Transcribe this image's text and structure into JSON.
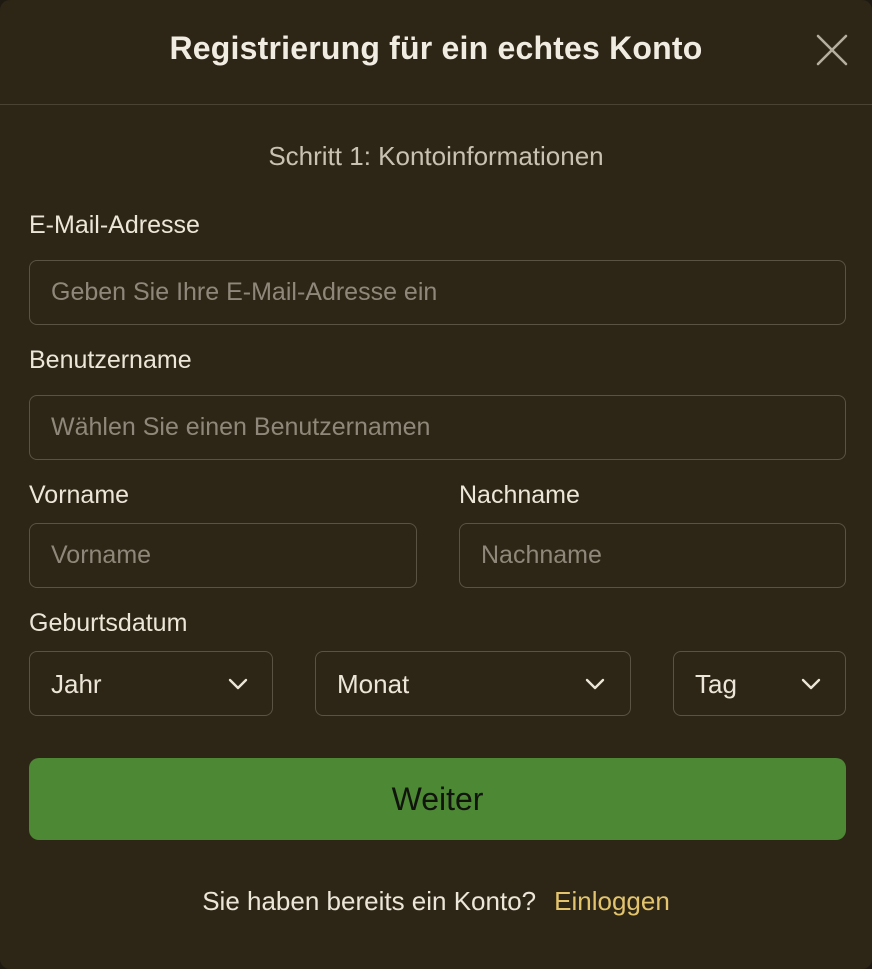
{
  "dialog": {
    "title": "Registrierung für ein echtes Konto",
    "close_icon": "close-icon"
  },
  "step": "Schritt 1: Kontoinformationen",
  "form": {
    "email": {
      "label": "E-Mail-Adresse",
      "value": "",
      "placeholder": "Geben Sie Ihre E-Mail-Adresse ein"
    },
    "username": {
      "label": "Benutzername",
      "value": "",
      "placeholder": "Wählen Sie einen Benutzernamen"
    },
    "first_name": {
      "label": "Vorname",
      "value": "",
      "placeholder": "Vorname"
    },
    "last_name": {
      "label": "Nachname",
      "value": "",
      "placeholder": "Nachname"
    },
    "birthdate": {
      "label": "Geburtsdatum",
      "year": "Jahr",
      "month": "Monat",
      "day": "Tag"
    },
    "submit_label": "Weiter"
  },
  "footer": {
    "prompt": "Sie haben bereits ein Konto?",
    "login_label": "Einloggen"
  },
  "colors": {
    "background": "#2d2617",
    "accent_button": "#4d8834",
    "link": "#e2c46e",
    "border": "#5a5242"
  },
  "icons": [
    "close-icon",
    "chevron-down-icon"
  ]
}
